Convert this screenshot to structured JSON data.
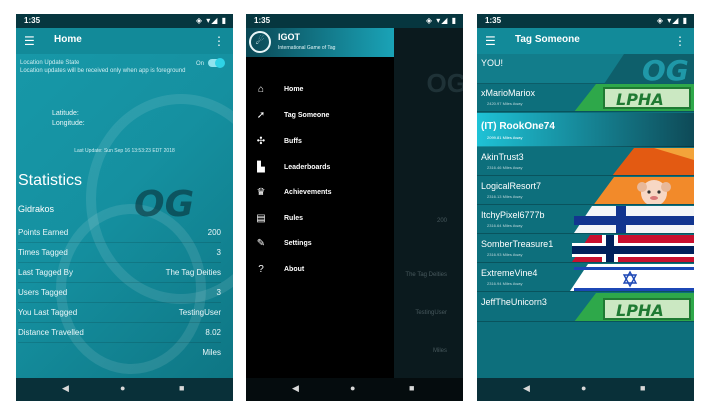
{
  "status": {
    "time": "1:35",
    "icons": "◈ ▾◢ ▮"
  },
  "nav": {
    "back": "◀",
    "home": "●",
    "recent": "■"
  },
  "home_screen": {
    "title": "Home",
    "menu_icon": "hamburger-icon",
    "more_icon": "overflow-icon",
    "location_title": "Location Update State",
    "location_subtitle": "Location updates will be received only when app is foreground",
    "toggle_state": "On",
    "latitude_label": "Latitude:",
    "longitude_label": "Longitude:",
    "last_update": "Last Update: Sun Sep 16 13:53:23 EDT 2018",
    "stats_title": "Statistics",
    "player_name": "Gidrakos",
    "stats": [
      {
        "label": "Points Earned",
        "value": "200"
      },
      {
        "label": "Times Tagged",
        "value": "3"
      },
      {
        "label": "Last Tagged By",
        "value": "The Tag Deities"
      },
      {
        "label": "Users Tagged",
        "value": "3"
      },
      {
        "label": "You Last Tagged",
        "value": "TestingUser"
      },
      {
        "label": "Distance Travelled",
        "value": "8.02"
      },
      {
        "label": "",
        "value": "Miles"
      }
    ],
    "watermark": "OG"
  },
  "drawer": {
    "app_title": "IGOT",
    "app_subtitle": "International Game of Tag",
    "items": [
      {
        "label": "Home",
        "icon": "home-icon"
      },
      {
        "label": "Tag Someone",
        "icon": "tag-icon"
      },
      {
        "label": "Buffs",
        "icon": "buff-icon"
      },
      {
        "label": "Leaderboards",
        "icon": "leaderboard-icon"
      },
      {
        "label": "Achievements",
        "icon": "trophy-icon"
      },
      {
        "label": "Rules",
        "icon": "clipboard-icon"
      },
      {
        "label": "Settings",
        "icon": "wrench-icon"
      },
      {
        "label": "About",
        "icon": "help-icon"
      }
    ],
    "bg_watermark": "OG",
    "bg_values": [
      "200",
      "The Tag Deities",
      "TestingUser",
      "Miles"
    ]
  },
  "tag_screen": {
    "title": "Tag Someone",
    "players": [
      {
        "name": "YOU!",
        "distance": "",
        "decor": "og-banner"
      },
      {
        "name": "xMarioMariox",
        "distance": "2420.97 Miles Away",
        "decor": "alpha-banner"
      },
      {
        "name": "(IT) RookOne74",
        "distance": "2099.81 Miles Away",
        "decor": "",
        "selected": true
      },
      {
        "name": "AkinTrust3",
        "distance": "2316.46 Miles Away",
        "decor": "orange-stripe"
      },
      {
        "name": "LogicalResort7",
        "distance": "2316.13 Miles Away",
        "decor": "monkey-avatar"
      },
      {
        "name": "ItchyPixel6777b",
        "distance": "2316.64 Miles Away",
        "decor": "finland-flag"
      },
      {
        "name": "SomberTreasure1",
        "distance": "2316.93 Miles Away",
        "decor": "norway-flag"
      },
      {
        "name": "ExtremeVine4",
        "distance": "2316.94 Miles Away",
        "decor": "israel-flag"
      },
      {
        "name": "JeffTheUnicorn3",
        "distance": "",
        "decor": "alpha-banner"
      }
    ],
    "og_text": "OG",
    "alpha_text": "LPHA"
  },
  "colors": {
    "appbar": "#128a99",
    "accent_toggle": "#2fd3e6",
    "drawer_bg": "#000000"
  }
}
